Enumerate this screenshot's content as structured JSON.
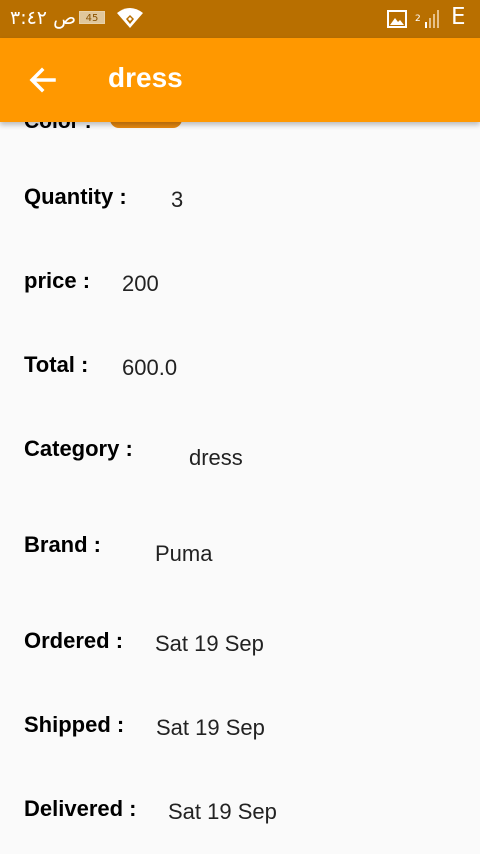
{
  "status_bar": {
    "time": "ص ٣:٤٢",
    "battery": "45",
    "signal_label": "2",
    "network_type": "E"
  },
  "app_bar": {
    "title": "dress"
  },
  "details": {
    "color_label": "Color :",
    "quantity_label": "Quantity :",
    "quantity_value": "3",
    "price_label": "price :",
    "price_value": "200",
    "total_label": "Total :",
    "total_value": "600.0",
    "category_label": "Category :",
    "category_value": "dress",
    "brand_label": "Brand :",
    "brand_value": "Puma",
    "ordered_label": "Ordered :",
    "ordered_value": "Sat 19 Sep",
    "shipped_label": "Shipped :",
    "shipped_value": "Sat 19 Sep",
    "delivered_label": "Delivered :",
    "delivered_value": "Sat 19 Sep"
  },
  "colors": {
    "status_bar": "#b86f00",
    "app_bar": "#ff9800",
    "color_chip": "#e8890f"
  }
}
